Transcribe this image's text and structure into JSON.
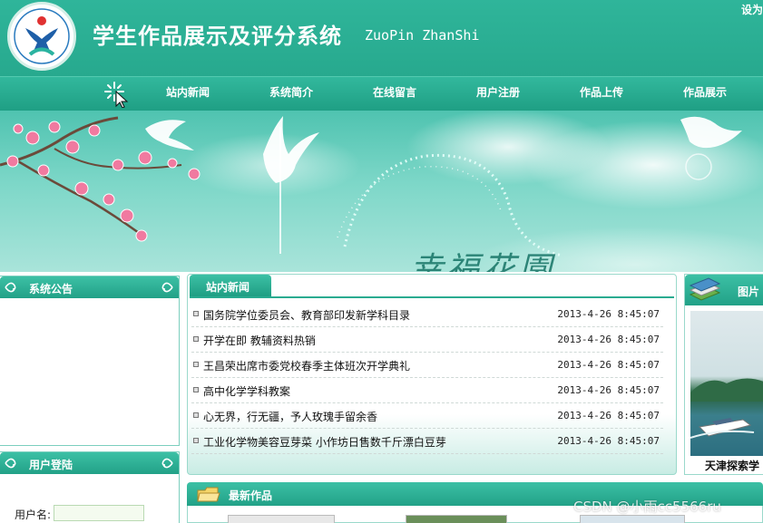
{
  "header": {
    "title": "学生作品展示及评分系统",
    "title_en": "ZuoPin ZhanShi",
    "top_link": "设为"
  },
  "nav": {
    "items": [
      "站内新闻",
      "系统简介",
      "在线留言",
      "用户注册",
      "作品上传",
      "作品展示"
    ]
  },
  "banner": {
    "text": "幸福花園"
  },
  "sidebar": {
    "notice_title": "系统公告",
    "login_title": "用户登陆",
    "username_label": "用户名:",
    "username_value": ""
  },
  "news": {
    "tab_label": "站内新闻",
    "items": [
      {
        "title": "国务院学位委员会、教育部印发新学科目录",
        "date": "2013-4-26 8:45:07"
      },
      {
        "title": "开学在即 教辅资料热销",
        "date": "2013-4-26 8:45:07"
      },
      {
        "title": "王昌荣出席市委党校春季主体班次开学典礼",
        "date": "2013-4-26 8:45:07"
      },
      {
        "title": "高中化学学科教案",
        "date": "2013-4-26 8:45:07"
      },
      {
        "title": "心无界，行无疆，予人玫瑰手留余香",
        "date": "2013-4-26 8:45:07"
      },
      {
        "title": "工业化学物美容豆芽菜 小作坊日售数千斤漂白豆芽",
        "date": "2013-4-26 8:45:07"
      }
    ]
  },
  "latest": {
    "title": "最新作品"
  },
  "pictures": {
    "title": "图片",
    "caption": "天津探索学"
  },
  "watermark": "CSDN @小雨cc5566ru",
  "colors": {
    "brand": "#2aab90",
    "header_bg": "#2fb59a",
    "text_white": "#ffffff"
  }
}
